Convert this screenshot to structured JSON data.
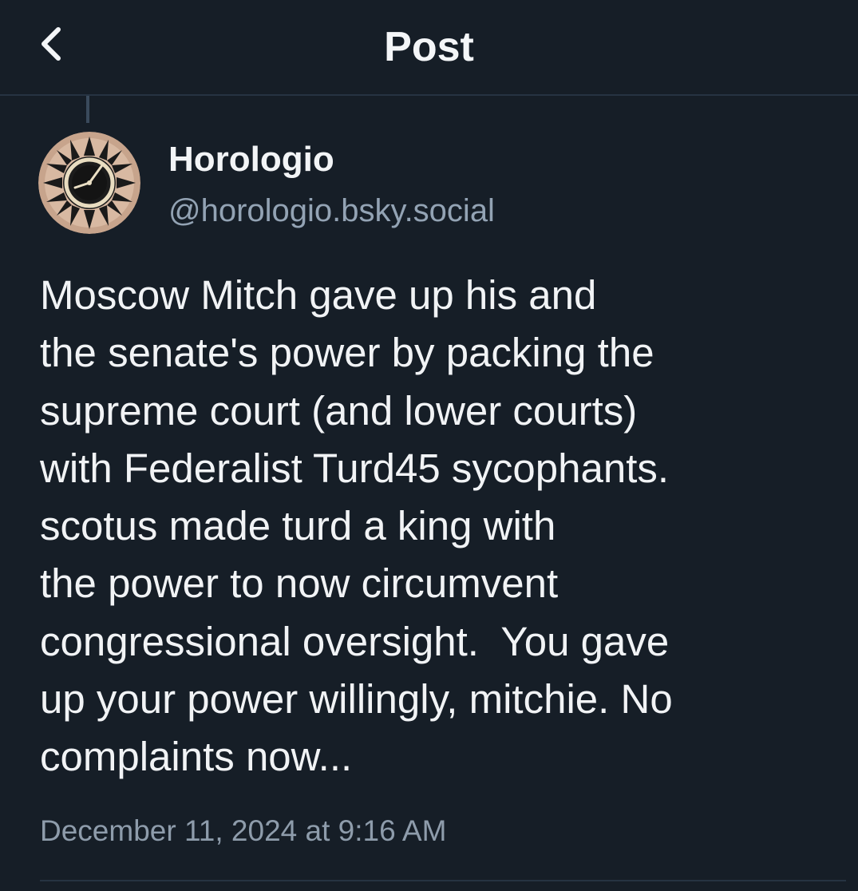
{
  "header": {
    "title": "Post",
    "back_icon": "chevron-left-icon"
  },
  "post": {
    "author": {
      "display_name": "Horologio",
      "handle": "@horologio.bsky.social",
      "avatar_icon": "clock-icon"
    },
    "text": "Moscow Mitch gave up his and\nthe senate's power by packing the\nsupreme court (and lower courts)\nwith Federalist Turd45 sycophants.\nscotus made turd a king with\nthe power to now circumvent\ncongressional oversight.  You gave\nup your power willingly, mitchie. No\ncomplaints now...",
    "timestamp": "December 11, 2024 at 9:16 AM"
  },
  "colors": {
    "background": "#161e27",
    "text": "#f1f3f5",
    "secondary_text": "#93a3b4",
    "divider": "#263342"
  }
}
